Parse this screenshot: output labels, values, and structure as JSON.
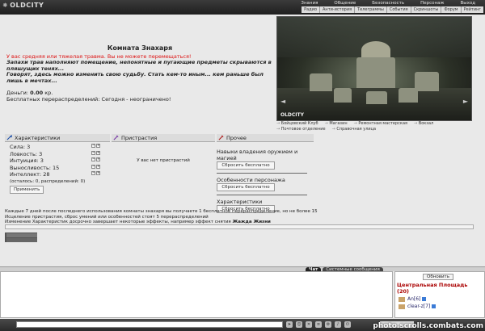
{
  "topbar": {
    "logo": "OLDCITY",
    "nav": [
      "Знания",
      "Общение",
      "Безопасность",
      "Персонаж",
      "Выход"
    ],
    "subnav": [
      "Радио",
      "Анти-история",
      "Телеграммы",
      "События",
      "Скриншоты",
      "Форум",
      "Рейтинг"
    ]
  },
  "picture": {
    "caption": "OLDCITY"
  },
  "links": {
    "row1": [
      "Бойцовский Клуб",
      "Магазин",
      "Ремонтная мастерская",
      "Вокзал"
    ],
    "row2": [
      "Почтовое отделение",
      "Справочная улица"
    ]
  },
  "room": {
    "title": "Комната Знахаря",
    "warning": "У вас средняя или тяжелая травма. Вы не можете перемещаться!",
    "desc1": "Запахи трав наполняют помещение, непонятные и пугающие предметы скрываются в пляшущих тенях...",
    "desc2": "Говорят, здесь можно изменить свою судьбу. Стать кем-то иным... кем раньше был лишь в мечтах...",
    "money_label": "Деньги:",
    "money_value": "0.00",
    "money_unit": "кр.",
    "free_redistribution": "Бесплатных перераспределений: Сегодня - неограничено!"
  },
  "characteristics": {
    "title": "Характеристики",
    "stats": [
      {
        "label": "Сила:",
        "value": "3"
      },
      {
        "label": "Ловкость:",
        "value": "3"
      },
      {
        "label": "Интуиция:",
        "value": "3"
      },
      {
        "label": "Выносливость:",
        "value": "15"
      },
      {
        "label": "Интеллект:",
        "value": "28"
      }
    ],
    "remaining": "(осталось: 0, распределений: 0)",
    "apply": "Применить"
  },
  "addictions": {
    "title": "Пристрастия",
    "empty": "У вас нет пристрастий"
  },
  "misc": {
    "title": "Прочее",
    "section1": "Навыки владения оружием и магией",
    "section2": "Особенности персонажа",
    "section3": "Характеристики",
    "reset": "Сбросить бесплатно"
  },
  "notes": {
    "line1": "Каждые 7 дней после последнего использования комнаты знахаря вы получаете 1 бесплатное перераспределение, но не более 15",
    "line2": "Исцеление пристрастия, сброс умений или особенностей стоят 5 перераспределений",
    "line3": "Изменение Характеристик досрочно завершает некоторые эффекты, например эффект снятия",
    "line3_bold": "Жажда Жизни"
  },
  "chat": {
    "tabs": [
      "Чат",
      "Системные сообщения"
    ]
  },
  "sidebar": {
    "refresh": "Обновить",
    "location": "Центральная Площадь",
    "count": "(20)",
    "users": [
      {
        "name": "An",
        "level": "[6]"
      },
      {
        "name": "clear-z",
        "level": "[7]"
      }
    ]
  },
  "watermark": "photo.scrolls.combats.com"
}
